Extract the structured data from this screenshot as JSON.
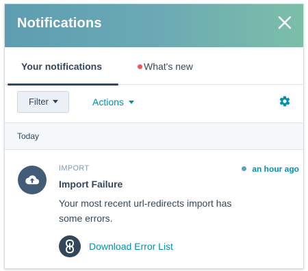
{
  "header": {
    "title": "Notifications",
    "close_icon": "close-icon"
  },
  "tabs": [
    {
      "label": "Your notifications",
      "active": true
    },
    {
      "label": "What's new",
      "active": false,
      "has_unread_dot": true
    }
  ],
  "toolbar": {
    "filter_label": "Filter",
    "actions_label": "Actions",
    "settings_icon": "gear-icon"
  },
  "section": {
    "label": "Today"
  },
  "notification": {
    "category": "IMPORT",
    "time": "an hour ago",
    "title": "Import Failure",
    "body": "Your most recent url-redirects import has some errors.",
    "icon": "cloud-upload-icon",
    "link": {
      "label": "Download Error List",
      "icon": "link-icon"
    }
  },
  "colors": {
    "header_gradient_start": "#5e9db1",
    "header_gradient_end": "#7bbfa8",
    "text_primary": "#33475b",
    "link": "#0091ae",
    "unread_dot": "#f2545b",
    "avatar_bg": "#425b76"
  }
}
